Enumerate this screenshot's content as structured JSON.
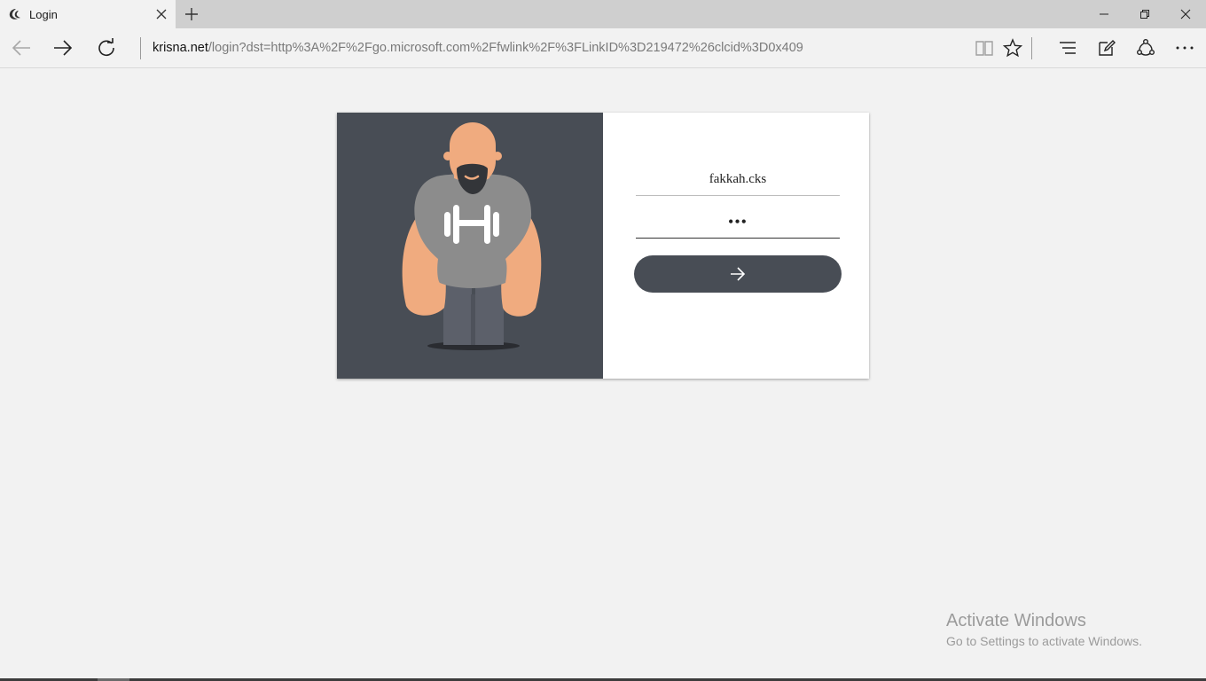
{
  "browser": {
    "tab_title": "Login",
    "address_host": "krisna.net",
    "address_rest": "/login?dst=http%3A%2F%2Fgo.microsoft.com%2Ffwlink%2F%3FLinkID%3D219472%26clcid%3D0x409"
  },
  "login": {
    "username_value": "fakkah.cks",
    "password_value": "•••",
    "submit_icon": "arrow-right-icon"
  },
  "watermark": {
    "title": "Activate Windows",
    "subtitle": "Go to Settings to activate Windows."
  },
  "colors": {
    "panel_dark": "#484d55",
    "skin": "#f0ab7f",
    "shirt": "#8c8c8c",
    "pants": "#5c606a"
  }
}
